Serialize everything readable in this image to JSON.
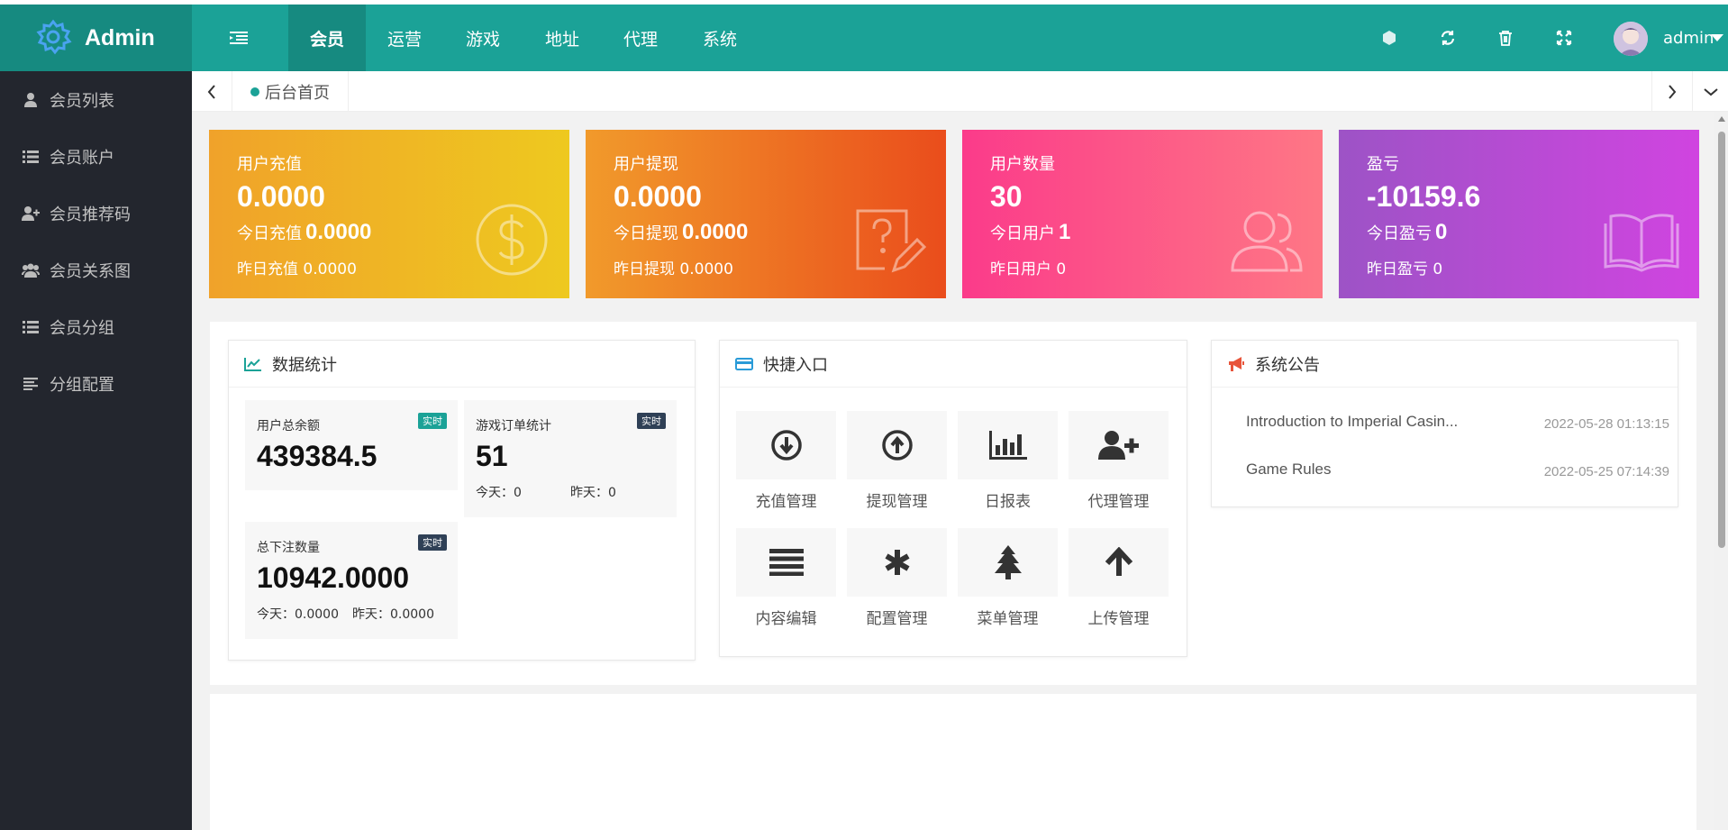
{
  "brand": {
    "name": "Admin"
  },
  "nav": {
    "items": [
      {
        "label": "会员",
        "active": true
      },
      {
        "label": "运营",
        "active": false
      },
      {
        "label": "游戏",
        "active": false
      },
      {
        "label": "地址",
        "active": false
      },
      {
        "label": "代理",
        "active": false
      },
      {
        "label": "系统",
        "active": false
      }
    ]
  },
  "toolbar": {
    "icons": [
      "cube-icon",
      "refresh-icon",
      "trash-icon",
      "fullscreen-icon"
    ],
    "user": "admin"
  },
  "sidebar": {
    "items": [
      {
        "label": "会员列表",
        "icon": "user-icon"
      },
      {
        "label": "会员账户",
        "icon": "list-icon"
      },
      {
        "label": "会员推荐码",
        "icon": "user-plus-icon"
      },
      {
        "label": "会员关系图",
        "icon": "users-icon"
      },
      {
        "label": "会员分组",
        "icon": "list-icon"
      },
      {
        "label": "分组配置",
        "icon": "align-left-icon"
      }
    ]
  },
  "tabs": {
    "home": "后台首页"
  },
  "cards": [
    {
      "title": "用户充值",
      "value": "0.0000",
      "today_label": "今日充值",
      "today_value": "0.0000",
      "yesterday": "昨日充值 0.0000",
      "icon": "dollar-icon",
      "gradient": [
        "#f0a22a",
        "#eec91f"
      ]
    },
    {
      "title": "用户提现",
      "value": "0.0000",
      "today_label": "今日提现",
      "today_value": "0.0000",
      "yesterday": "昨日提现 0.0000",
      "icon": "question-edit-icon",
      "gradient": [
        "#f19a2b",
        "#ea4d1c"
      ]
    },
    {
      "title": "用户数量",
      "value": "30",
      "today_label": "今日用户",
      "today_value": "1",
      "yesterday": "昨日用户 0",
      "icon": "users-outline-icon",
      "gradient": [
        "#fb3b8a",
        "#fe7785"
      ]
    },
    {
      "title": "盈亏",
      "value": "-10159.6",
      "today_label": "今日盈亏",
      "today_value": "0",
      "yesterday": "昨日盈亏 0",
      "icon": "book-icon",
      "gradient": [
        "#9d53c6",
        "#d044e0"
      ]
    }
  ],
  "stats_panel": {
    "title": "数据统计",
    "boxes": [
      {
        "label": "用户总余额",
        "badge": "实时",
        "value": "439384.5"
      },
      {
        "label": "游戏订单统计",
        "badge": "实时",
        "value": "51",
        "today": "今天：0",
        "yesterday": "昨天：0"
      },
      {
        "label": "总下注数量",
        "badge": "实时",
        "value": "10942.0000",
        "today": "今天：0.0000",
        "yesterday": "昨天：0.0000"
      }
    ]
  },
  "quick_panel": {
    "title": "快捷入口",
    "items": [
      {
        "label": "充值管理",
        "icon": "arrow-circle-down-icon"
      },
      {
        "label": "提现管理",
        "icon": "arrow-circle-up-icon"
      },
      {
        "label": "日报表",
        "icon": "bar-chart-icon"
      },
      {
        "label": "代理管理",
        "icon": "user-plus-icon"
      },
      {
        "label": "内容编辑",
        "icon": "bars-icon"
      },
      {
        "label": "配置管理",
        "icon": "asterisk-icon"
      },
      {
        "label": "菜单管理",
        "icon": "tree-icon"
      },
      {
        "label": "上传管理",
        "icon": "arrow-up-icon"
      }
    ]
  },
  "notice_panel": {
    "title": "系统公告",
    "items": [
      {
        "title": "Introduction to Imperial Casin...",
        "date": "2022-05-28 01:13:15"
      },
      {
        "title": "Game Rules",
        "date": "2022-05-25 07:14:39"
      }
    ]
  },
  "colors": {
    "primary": "#1ba297",
    "primary_dark": "#168a80",
    "sidebar_bg": "#23262e",
    "badge_green": "#1ba297",
    "badge_dark": "#2f4056"
  }
}
